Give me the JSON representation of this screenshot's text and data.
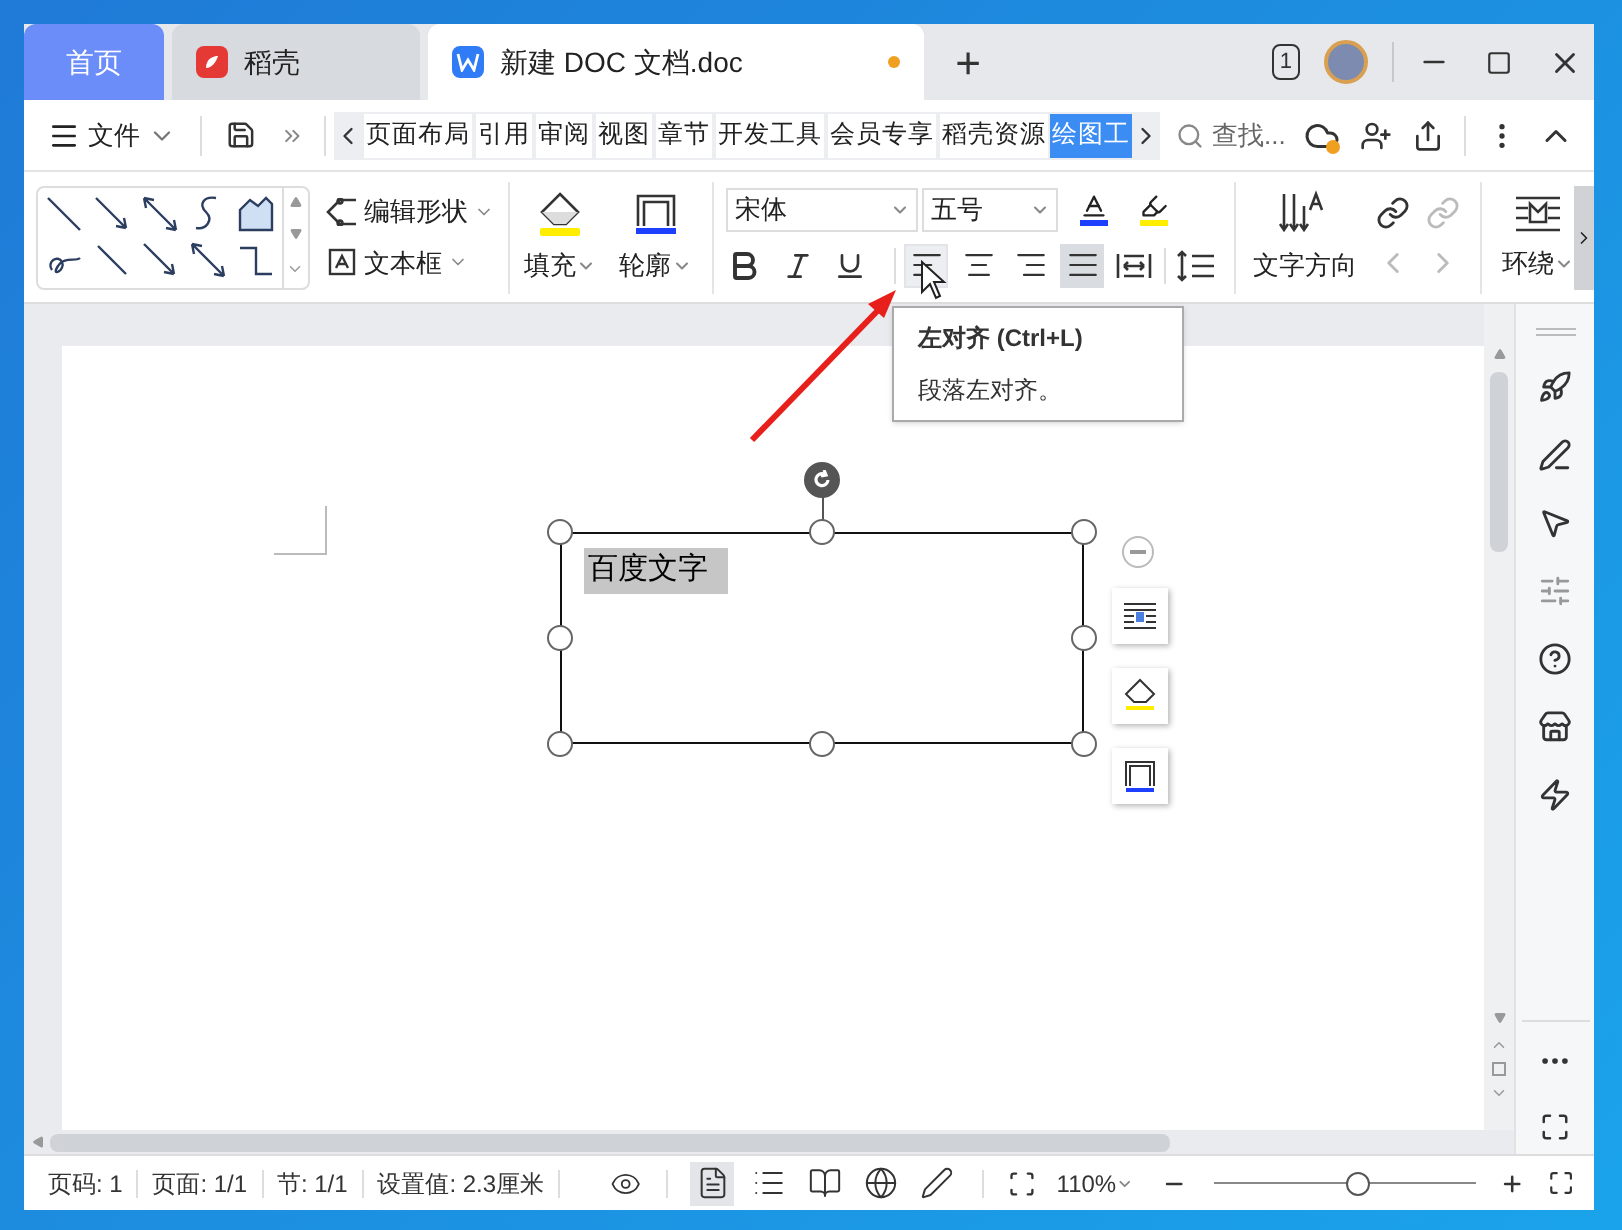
{
  "tabs": [
    {
      "label": "首页",
      "kind": "home",
      "selected": false
    },
    {
      "label": "稻壳",
      "kind": "app",
      "selected": false
    },
    {
      "label": "新建 DOC 文档.doc",
      "kind": "document",
      "selected": true,
      "unsaved": true
    }
  ],
  "new_tab": "+",
  "window_count": "1",
  "menu": {
    "file": "文件",
    "ribbon_tabs": [
      {
        "label": "页面布局",
        "selected": false
      },
      {
        "label": "引用",
        "selected": false
      },
      {
        "label": "审阅",
        "selected": false
      },
      {
        "label": "视图",
        "selected": false
      },
      {
        "label": "章节",
        "selected": false
      },
      {
        "label": "开发工具",
        "selected": false
      },
      {
        "label": "会员专享",
        "selected": false
      },
      {
        "label": "稻壳资源",
        "selected": false
      },
      {
        "label": "绘图工",
        "selected": true
      }
    ],
    "search": {
      "placeholder": "查找..."
    }
  },
  "ribbon": {
    "shape_tools": [
      {
        "label": "编辑形状",
        "kind": "edit"
      },
      {
        "label": "文本框",
        "kind": "textbox"
      }
    ],
    "fill": "填充",
    "outline": "轮廓",
    "font": "宋体",
    "font_size": "五号",
    "alignments": [
      {
        "kind": "left",
        "selected": false,
        "hovered": true
      },
      {
        "kind": "center",
        "selected": false,
        "hovered": false
      },
      {
        "kind": "right",
        "selected": false,
        "hovered": false
      },
      {
        "kind": "justify",
        "selected": true,
        "hovered": false
      },
      {
        "kind": "distributed",
        "selected": false,
        "hovered": false
      }
    ],
    "text_direction": "文字方向",
    "wrap": "环绕"
  },
  "tooltip": {
    "title": "左对齐 (Ctrl+L)",
    "description": "段落左对齐。"
  },
  "document": {
    "textbox_text": "百度文字",
    "text_selected": true
  },
  "status_bar": {
    "items": [
      "页码: 1",
      "页面: 1/1",
      "节: 1/1",
      "设置值: 2.3厘米"
    ],
    "view_modes": [
      {
        "kind": "page",
        "selected": true
      },
      {
        "kind": "outline",
        "selected": false
      },
      {
        "kind": "reading",
        "selected": false
      },
      {
        "kind": "web",
        "selected": false
      },
      {
        "kind": "pen",
        "selected": false
      }
    ],
    "zoom": "110%",
    "zoom_slider": {
      "level": 0.55
    }
  }
}
